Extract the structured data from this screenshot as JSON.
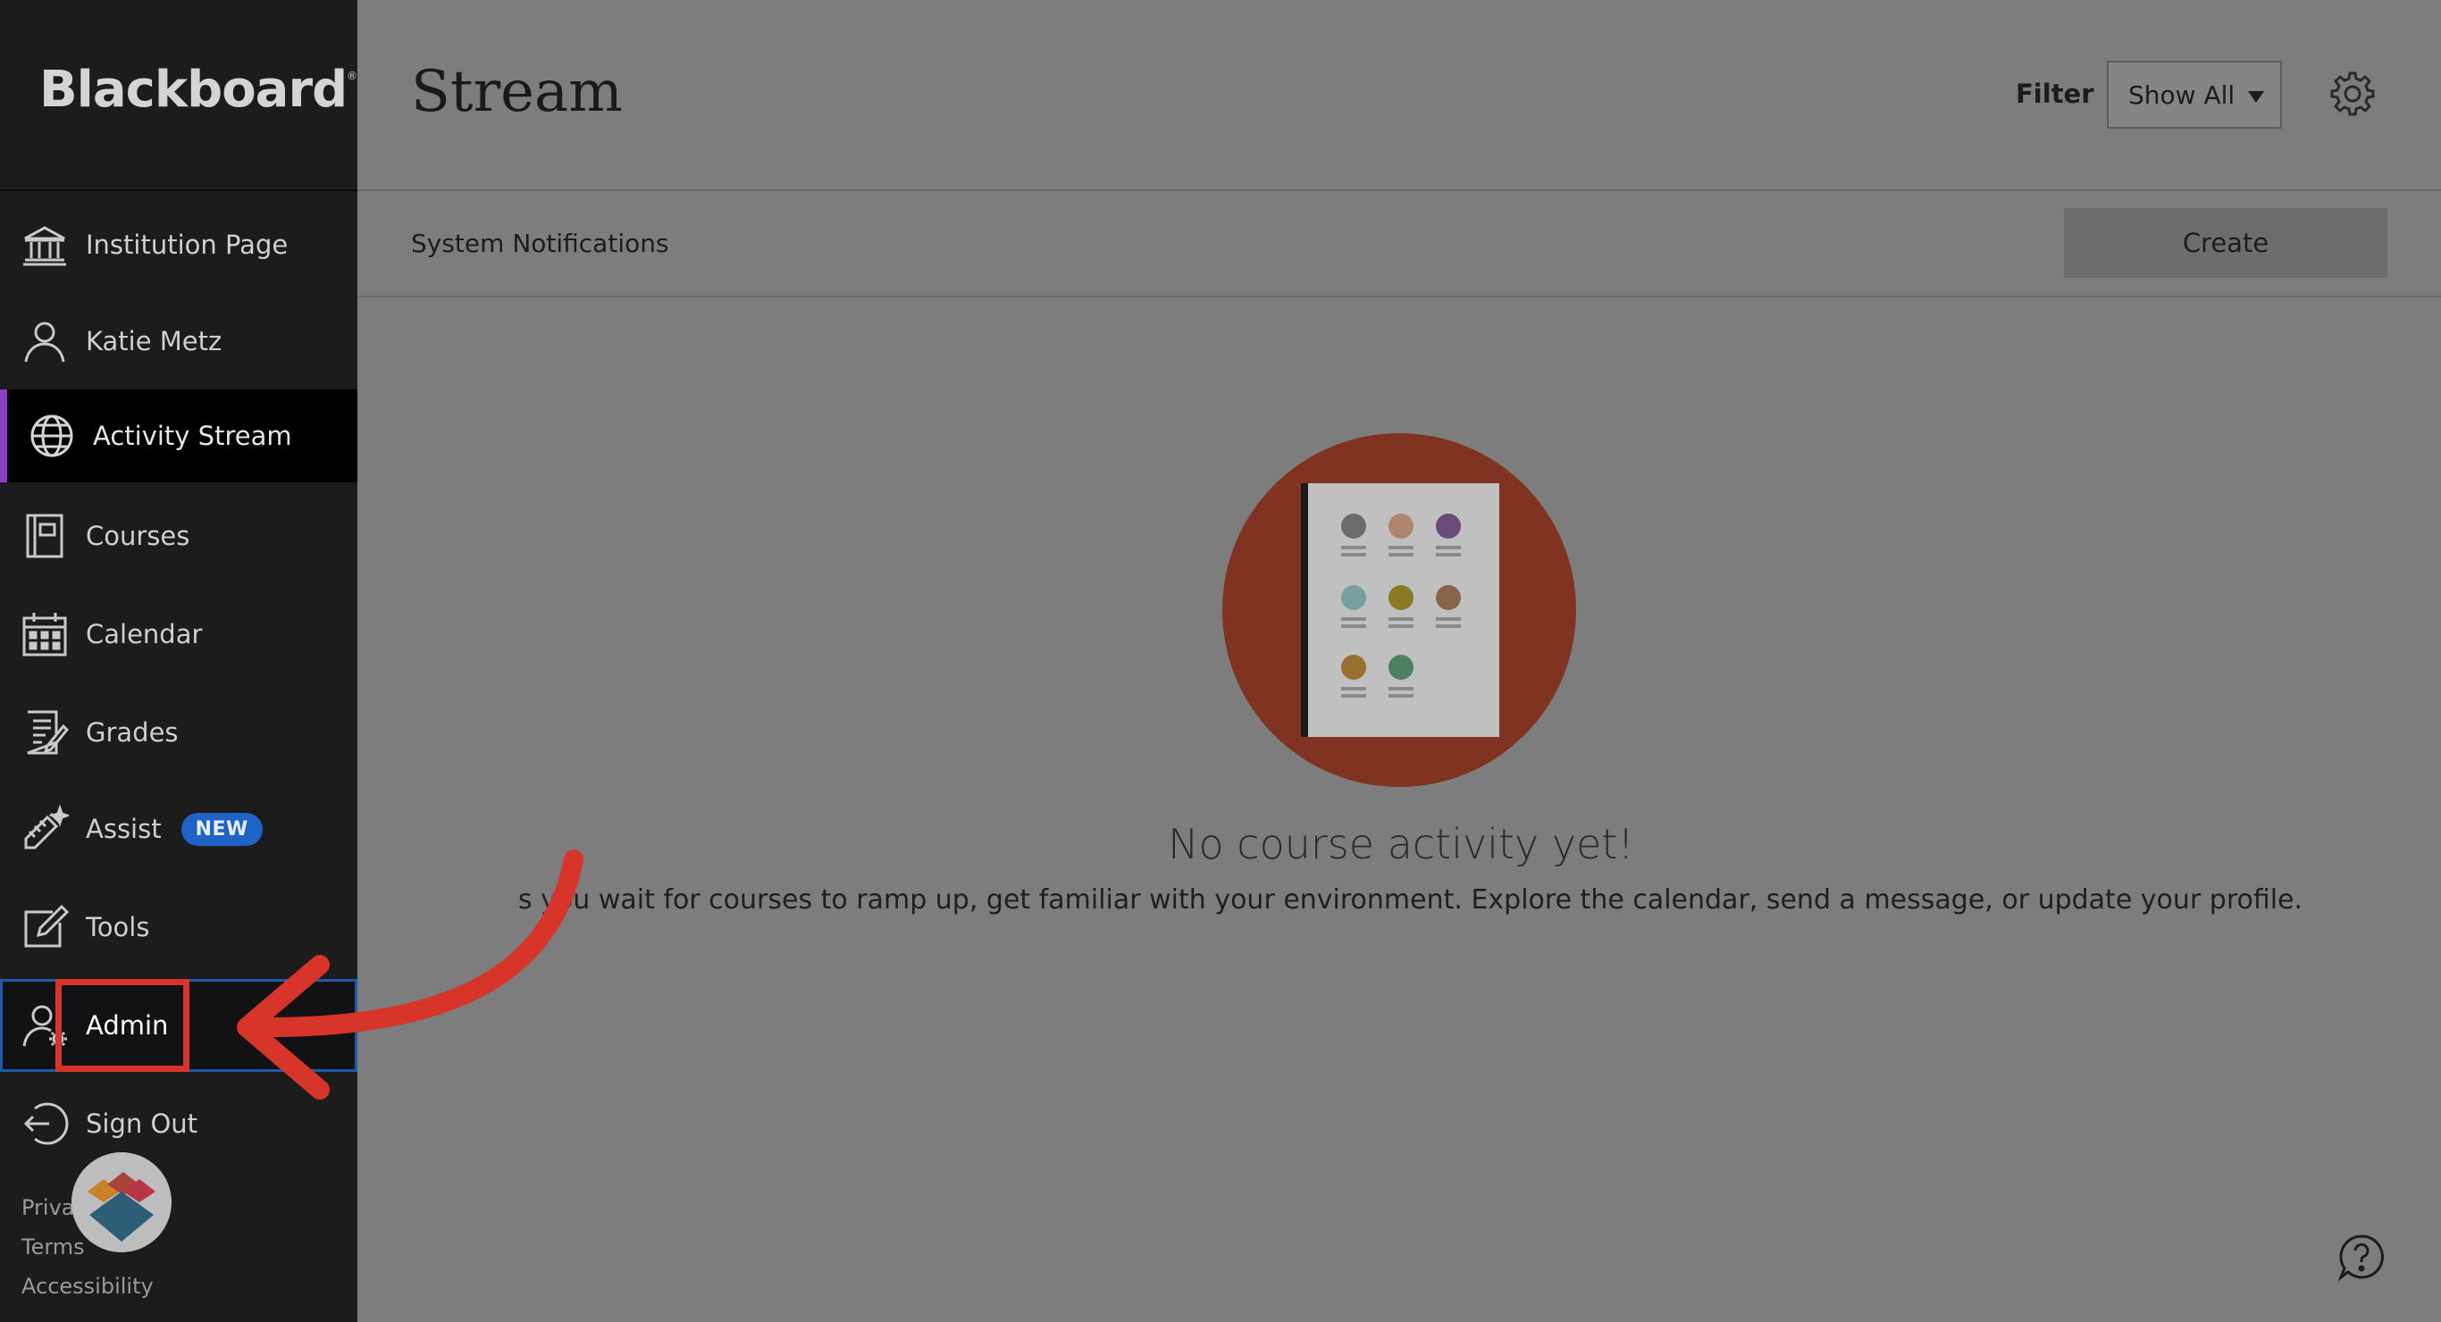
{
  "app": {
    "logo_text": "Blackboard"
  },
  "sidebar": {
    "items": [
      {
        "label": "Institution Page",
        "icon": "institution-icon"
      },
      {
        "label": "Katie Metz",
        "icon": "user-icon"
      },
      {
        "label": "Activity Stream",
        "icon": "globe-icon",
        "active": true
      },
      {
        "label": "Courses",
        "icon": "courses-icon"
      },
      {
        "label": "Calendar",
        "icon": "calendar-icon"
      },
      {
        "label": "Grades",
        "icon": "grades-icon"
      },
      {
        "label": "Assist",
        "icon": "assist-icon",
        "badge": "NEW"
      },
      {
        "label": "Tools",
        "icon": "tools-icon"
      },
      {
        "label": "Admin",
        "icon": "admin-icon",
        "highlighted": true
      },
      {
        "label": "Sign Out",
        "icon": "sign-out-icon"
      }
    ],
    "footer": [
      "Priva",
      "Terms",
      "Accessibility"
    ]
  },
  "header": {
    "title": "Stream",
    "filter_label": "Filter",
    "filter_value": "Show All"
  },
  "notifications": {
    "label": "System Notifications",
    "create_label": "Create"
  },
  "empty_state": {
    "title": "No course activity yet!",
    "body": "s you wait for courses to ramp up, get familiar with your environment. Explore the calendar, send a message, or update your profile."
  },
  "colors": {
    "accent_active": "#8b3fc7",
    "annotation_red": "#d7352a",
    "badge_blue": "#1f63c6",
    "illustration_circle": "#7f3320"
  }
}
